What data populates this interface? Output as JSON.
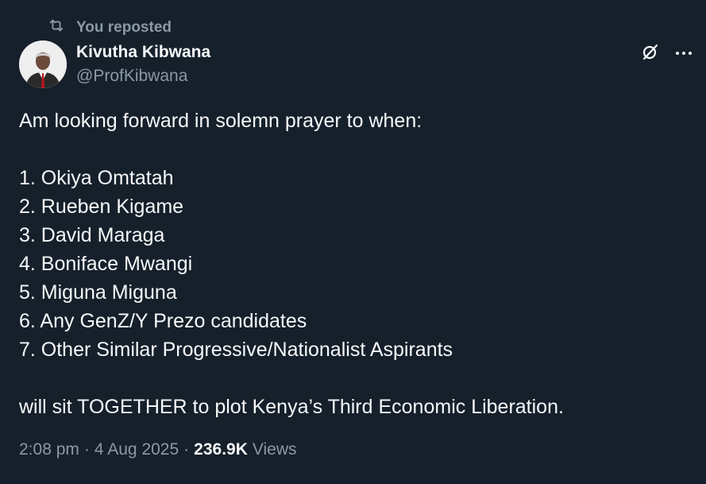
{
  "repost": {
    "label": "You reposted",
    "icon": "repost-icon"
  },
  "author": {
    "name": "Kivutha Kibwana",
    "handle": "@ProfKibwana",
    "avatar": "avatar-photo"
  },
  "actions": {
    "grok_icon": "grok-icon",
    "more_icon": "more-dots-icon"
  },
  "tweet": {
    "intro": "Am looking forward in solemn prayer to when:",
    "items": [
      "1. Okiya Omtatah",
      "2. Rueben Kigame",
      "3. David Maraga",
      "4. Boniface Mwangi",
      "5. Miguna Miguna",
      "6. Any GenZ/Y Prezo candidates",
      "7. Other Similar Progressive/Nationalist Aspirants"
    ],
    "outro": "will sit TOGETHER to plot Kenya’s Third Economic Liberation."
  },
  "meta": {
    "time": "2:08 pm",
    "separator": "·",
    "date": "4 Aug 2025",
    "views_count": "236.9K",
    "views_label": "Views"
  },
  "colors": {
    "background": "#15202b",
    "text": "#f7f9f9",
    "muted": "#8b98a5"
  }
}
